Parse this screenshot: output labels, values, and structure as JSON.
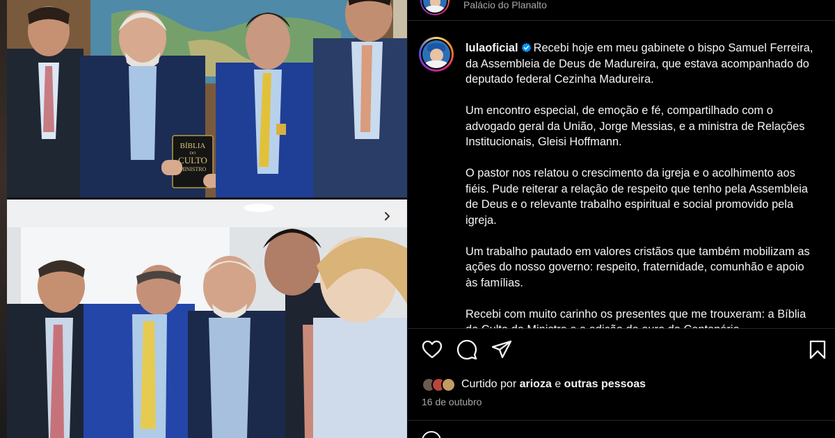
{
  "header": {
    "location": "Palácio do Planalto",
    "avatar_icon": "profile-avatar"
  },
  "post": {
    "username": "lulaoficial",
    "verified_icon": "verified-badge-icon",
    "caption_paragraphs": [
      "Recebi hoje em meu gabinete o bispo Samuel Ferreira, da Assembleia de Deus de Madureira, que estava acompanhado do deputado federal Cezinha Madureira.",
      "Um encontro especial, de emoção e fé, compartilhado com o advogado geral da União, Jorge Messias, e a ministra de Relações Institucionais, Gleisi Hoffmann.",
      "O pastor nos relatou o crescimento da igreja e o acolhimento aos fiéis. Pude reiterar a relação de respeito que tenho pela Assembleia de Deus e o relevante trabalho espiritual e social promovido pela igreja.",
      "Um trabalho pautado em valores cristãos que também mobilizam as ações do nosso governo: respeito, fraternidade, comunhão e apoio às famílias.",
      "Recebi com muito carinho os presentes que me trouxeram: a Bíblia do Culto do Ministro e a edição de ouro do Centenário"
    ]
  },
  "photo": {
    "book_title_lines": [
      "BÍBLIA",
      "CULTO",
      "MINISTRO"
    ],
    "book_small_line": "DO"
  },
  "actions": {
    "icons": [
      "heart-icon",
      "comment-icon",
      "share-icon",
      "bookmark-icon"
    ]
  },
  "likes": {
    "prefix": "Curtido por",
    "user": "arioza",
    "connector": "e",
    "others": "outras pessoas"
  },
  "date": "16 de outubro",
  "colors": {
    "background": "#000000",
    "text": "#f5f5f5",
    "muted": "#a8a8a8",
    "verified": "#0095f6"
  }
}
